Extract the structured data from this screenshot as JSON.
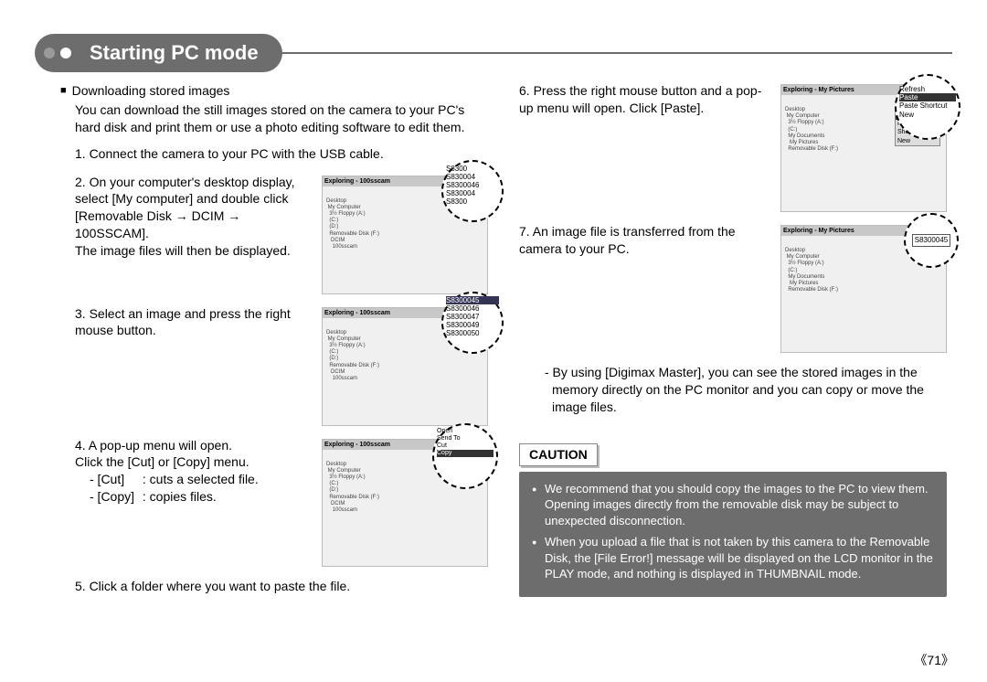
{
  "header": {
    "title": "Starting PC mode"
  },
  "left": {
    "sectionBullet": "■",
    "sectionTitle": "Downloading stored images",
    "intro": "You can download the still images stored on the camera to your PC's hard disk and print them or use a photo editing software to edit them.",
    "step1": "1. Connect the camera to your PC with the USB cable.",
    "step2a": "2. On your computer's desktop display, select [My computer] and double click [Removable Disk → DCIM → 100SSCAM].",
    "step2b": "The image files will then be displayed.",
    "step3": "3. Select an image and press the right mouse button.",
    "step4a": "4. A pop-up menu will open.",
    "step4b": "Click the [Cut] or [Copy] menu.",
    "step4c_label": "- [Cut]",
    "step4c_desc": ": cuts a selected file.",
    "step4d_label": "- [Copy]",
    "step4d_desc": ": copies files.",
    "step5": "5. Click a folder where you want to paste the file.",
    "img_files": [
      "S8300",
      "S830004",
      "S8300046",
      "S830004",
      "S8300"
    ],
    "img_files2": [
      "S8300045",
      "S8300046",
      "S8300047",
      "S8300049",
      "S8300050"
    ],
    "ctx1": {
      "items": [
        "Open",
        "Send To",
        "Cut",
        "Copy"
      ],
      "hl": "Copy"
    },
    "mini_title": "Exploring - 100sscam"
  },
  "right": {
    "step6": "6. Press the right mouse button and a pop-up menu will open. Click [Paste].",
    "step7": "7. An image file is transferred from the camera to your PC.",
    "ctx2": {
      "items": [
        "Refresh",
        "Paste",
        "Paste Shortcut",
        "New"
      ],
      "hl": "Paste"
    },
    "img_file_sel": "S8300045",
    "note": "- By using [Digimax Master], you can see the stored images in the memory directly on the PC monitor and you can copy or move the image files.",
    "mini_title": "Exploring - My Pictures"
  },
  "caution": {
    "label": "CAUTION",
    "items": [
      "We recommend that you should copy the images to the PC to view them. Opening images directly from the removable disk may be subject to unexpected disconnection.",
      "When you upload a file that is not taken by this camera to the Removable Disk, the [File Error!] message will be displayed on the LCD monitor in the PLAY mode, and nothing is displayed in THUMBNAIL mode."
    ]
  },
  "pageNumber": "《71》"
}
